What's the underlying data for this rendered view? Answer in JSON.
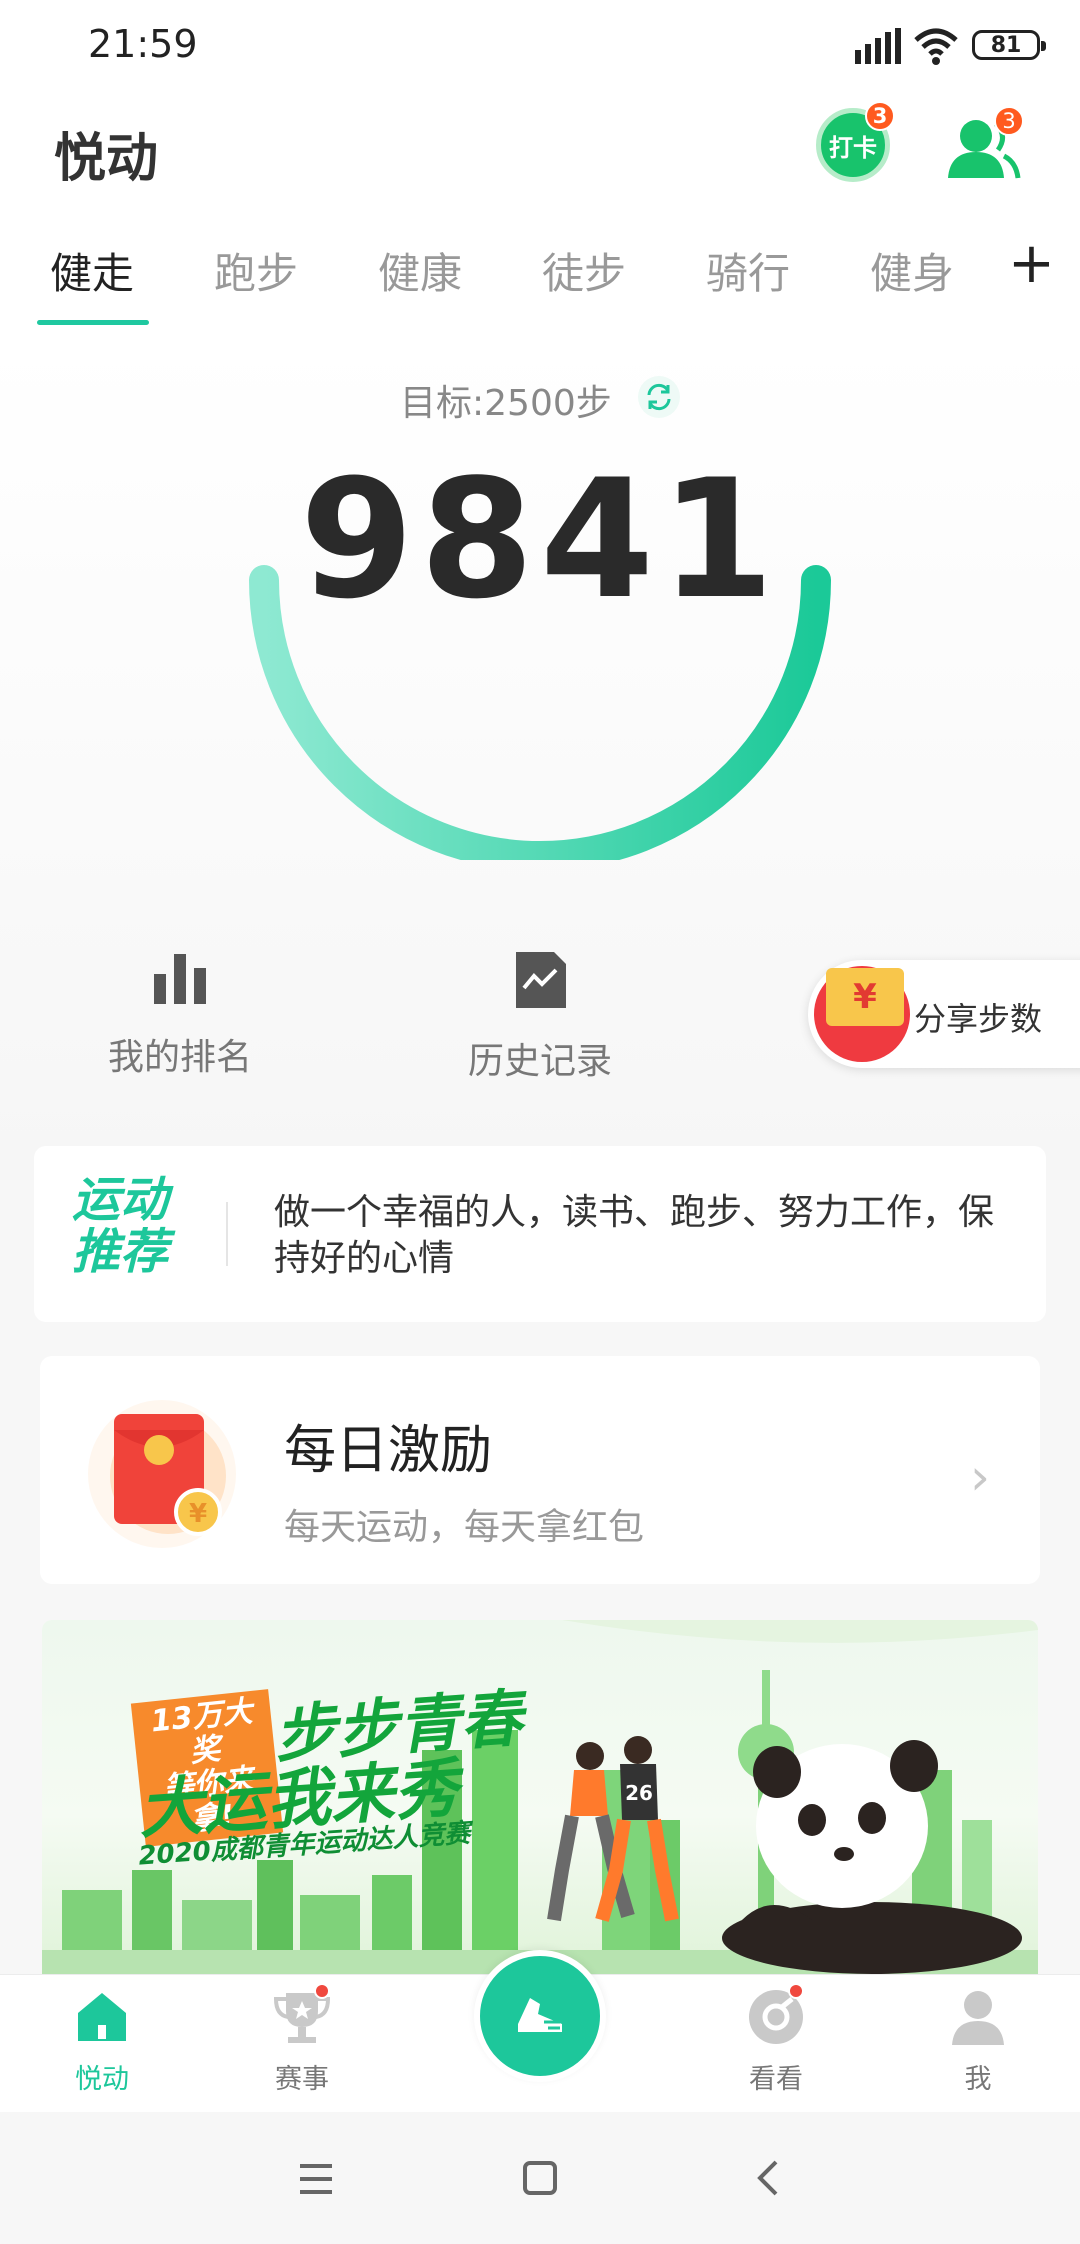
{
  "status_bar": {
    "time": "21:59",
    "battery": "81"
  },
  "header": {
    "title": "悦动",
    "checkin_label": "打卡",
    "checkin_badge": "3",
    "friends_badge": "3"
  },
  "tabs": [
    {
      "label": "健走"
    },
    {
      "label": "跑步"
    },
    {
      "label": "健康"
    },
    {
      "label": "徒步"
    },
    {
      "label": "骑行"
    },
    {
      "label": "健身"
    }
  ],
  "tab_add": "+",
  "steps": {
    "goal": "目标:2500步",
    "count": "9841"
  },
  "shortcuts": {
    "ranking": "我的排名",
    "history": "历史记录",
    "share": "分享步数",
    "share_symbol": "¥"
  },
  "recommend": {
    "title_line1": "运动",
    "title_line2": "推荐",
    "text": "做一个幸福的人，读书、跑步、努力工作，保持好的心情"
  },
  "daily": {
    "title": "每日激励",
    "subtitle": "每天运动，每天拿红包",
    "coin_symbol": "¥"
  },
  "banner": {
    "tag_line1": "13万大奖",
    "tag_line2": "等你来拿!",
    "headline1": "步步青春",
    "headline2": "大运我来秀",
    "subtitle": "2020成都青年运动达人竞赛",
    "jersey_number": "26"
  },
  "bottom_nav": [
    {
      "label": "悦动",
      "icon": "home-icon",
      "active": true
    },
    {
      "label": "赛事",
      "icon": "trophy-icon",
      "active": false
    },
    {
      "label": "看看",
      "icon": "discover-icon",
      "active": false
    },
    {
      "label": "我",
      "icon": "person-icon",
      "active": false
    }
  ],
  "colors": {
    "accent": "#1dc79b",
    "checkin": "#18c36c",
    "badge": "#ff5a1f",
    "red_envelope": "#ef3a40"
  }
}
